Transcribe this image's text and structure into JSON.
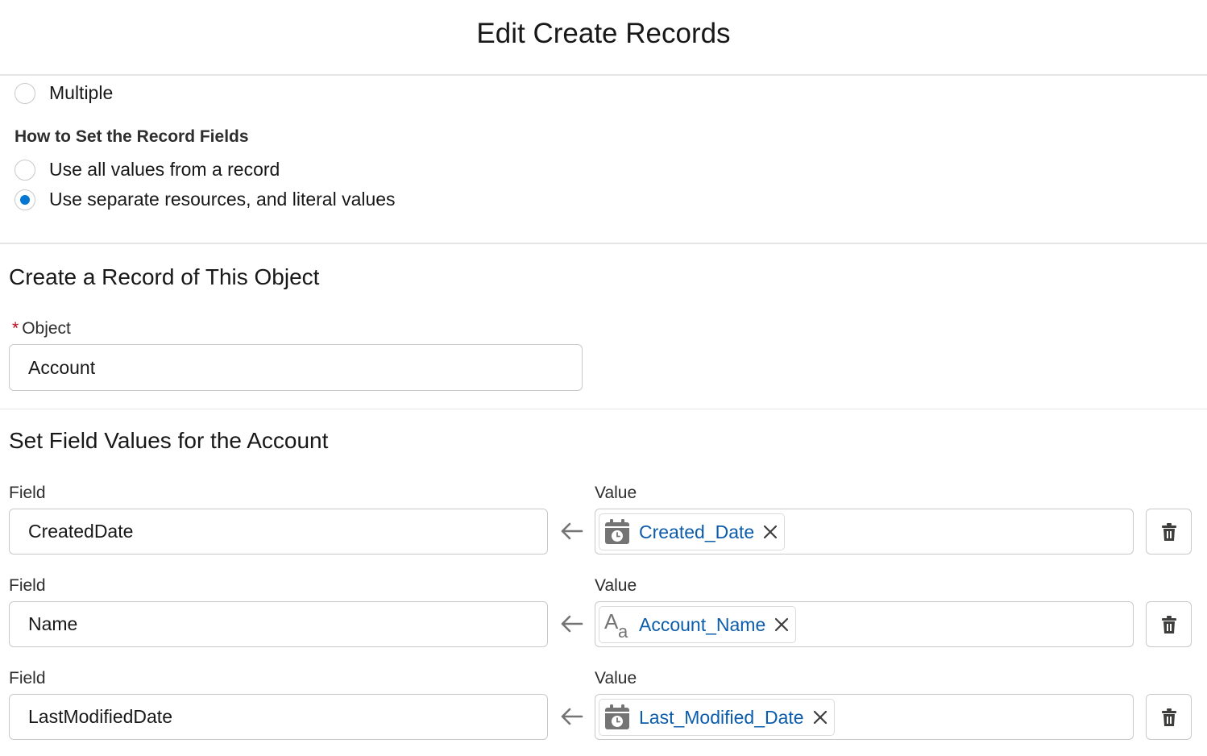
{
  "header": {
    "title": "Edit Create Records"
  },
  "record_count": {
    "option_multiple": {
      "label": "Multiple",
      "checked": false
    }
  },
  "how_to_set": {
    "heading": "How to Set the Record Fields",
    "options": [
      {
        "label": "Use all values from a record",
        "checked": false
      },
      {
        "label": "Use separate resources, and literal values",
        "checked": true
      }
    ]
  },
  "object_section": {
    "title": "Create a Record of This Object",
    "object_label": "Object",
    "required_marker": "*",
    "object_value": "Account"
  },
  "field_values_section": {
    "title": "Set Field Values for the Account",
    "field_label": "Field",
    "value_label": "Value",
    "rows": [
      {
        "field": "CreatedDate",
        "value": "Created_Date",
        "value_icon": "date-variable-icon"
      },
      {
        "field": "Name",
        "value": "Account_Name",
        "value_icon": "text-variable-icon"
      },
      {
        "field": "LastModifiedDate",
        "value": "Last_Modified_Date",
        "value_icon": "date-variable-icon"
      }
    ]
  },
  "colors": {
    "accent": "#0176d3",
    "link": "#0b5cab",
    "required": "#ba0517",
    "border": "#c9c9c9",
    "icon": "#747474"
  }
}
